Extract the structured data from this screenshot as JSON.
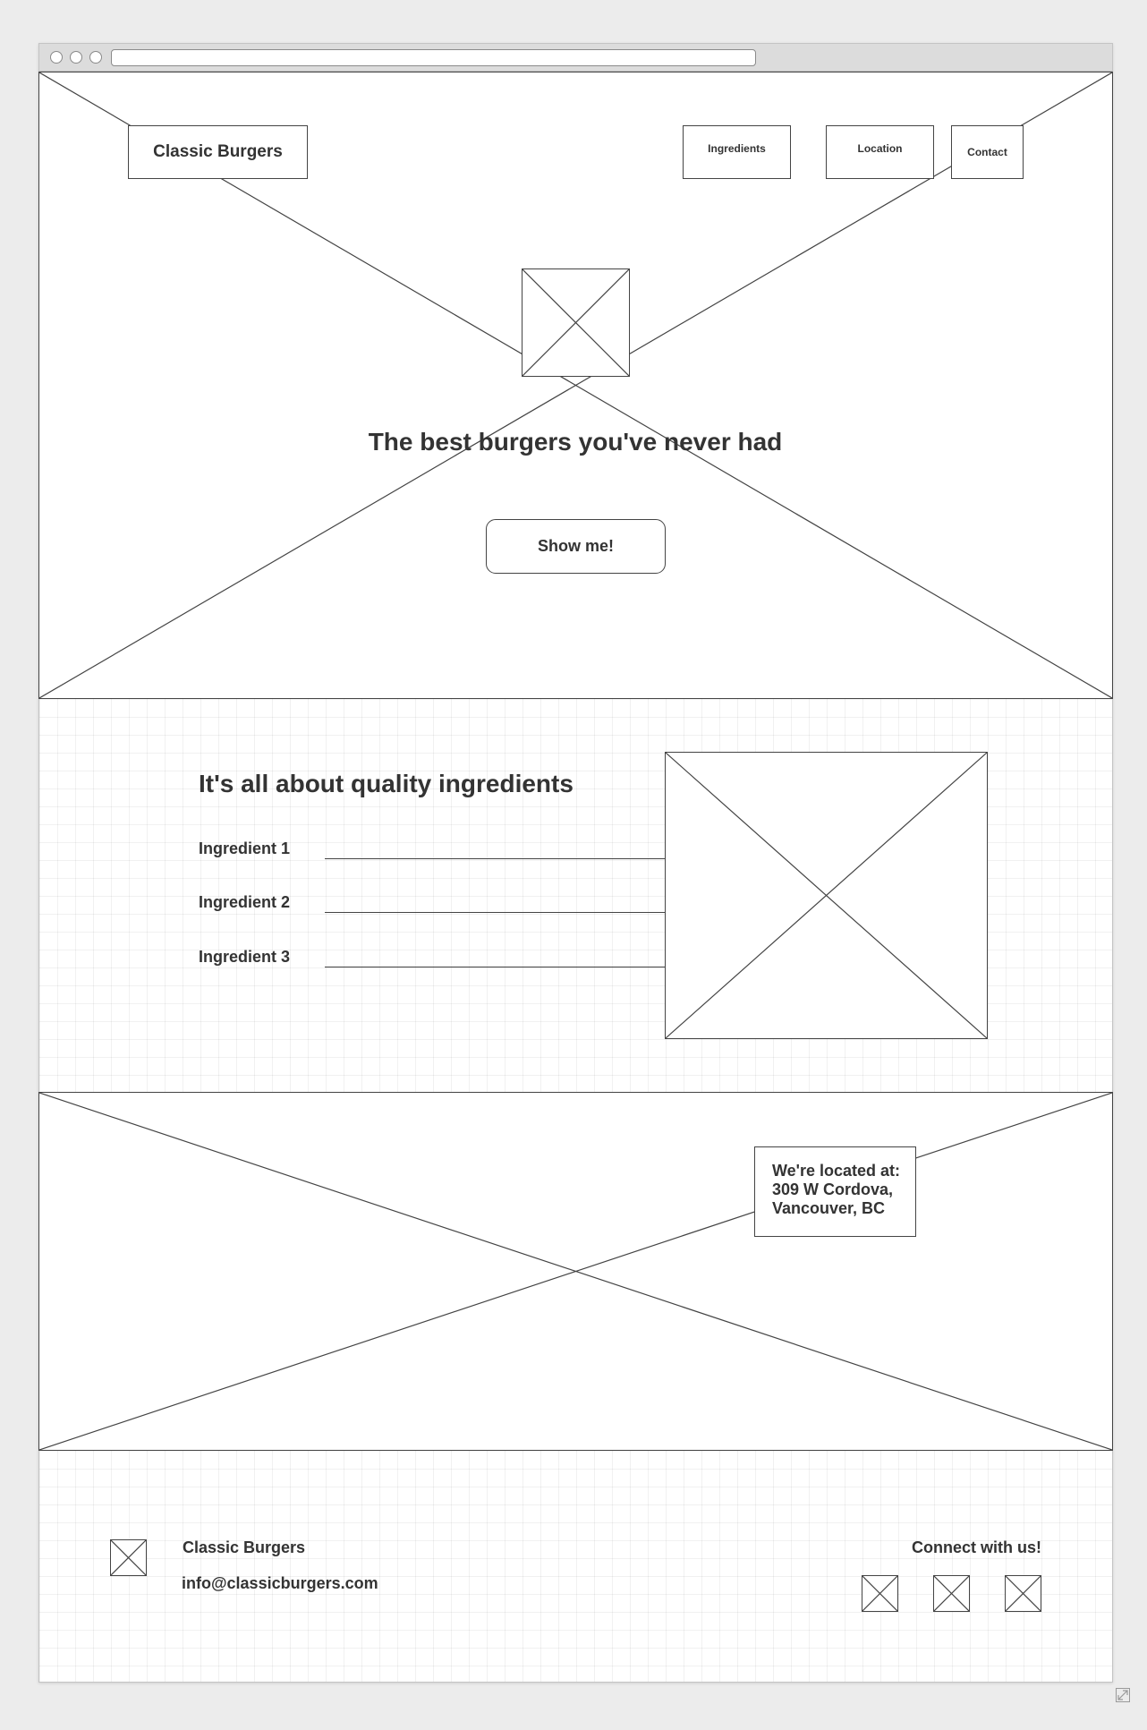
{
  "hero": {
    "brand": "Classic Burgers",
    "nav": [
      "Ingredients",
      "Location",
      "Contact"
    ],
    "headline": "The best burgers you've never had",
    "cta_label": "Show me!"
  },
  "ingredients_section": {
    "title": "It's all about quality ingredients",
    "items": [
      "Ingredient 1",
      "Ingredient 2",
      "Ingredient 3"
    ]
  },
  "location_section": {
    "lines": [
      "We're located at:",
      "309 W Cordova,",
      "Vancouver, BC"
    ]
  },
  "footer": {
    "brand": "Classic Burgers",
    "email": "info@classicburgers.com",
    "connect_label": "Connect with us!"
  },
  "icons": {
    "placeholder": "image-placeholder-icon",
    "resize": "resize-corner-icon"
  },
  "colors": {
    "page_bg": "#ececec",
    "line": "#444444",
    "text": "#333333"
  }
}
